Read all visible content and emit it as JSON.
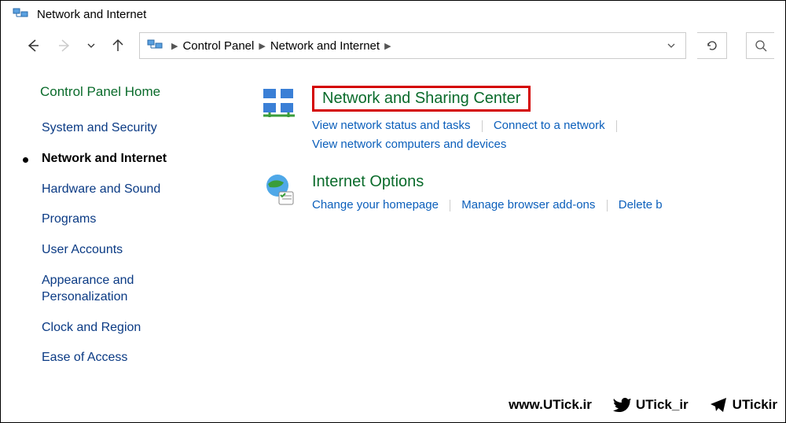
{
  "window": {
    "title": "Network and Internet"
  },
  "breadcrumb": {
    "root": "Control Panel",
    "current": "Network and Internet"
  },
  "sidebar": {
    "home": "Control Panel Home",
    "items": [
      {
        "label": "System and Security"
      },
      {
        "label": "Network and Internet",
        "active": true
      },
      {
        "label": "Hardware and Sound"
      },
      {
        "label": "Programs"
      },
      {
        "label": "User Accounts"
      },
      {
        "label": "Appearance and Personalization"
      },
      {
        "label": "Clock and Region"
      },
      {
        "label": "Ease of Access"
      }
    ]
  },
  "categories": [
    {
      "title": "Network and Sharing Center",
      "highlighted": true,
      "links": [
        "View network status and tasks",
        "Connect to a network",
        "View network computers and devices"
      ]
    },
    {
      "title": "Internet Options",
      "links": [
        "Change your homepage",
        "Manage browser add-ons",
        "Delete b"
      ]
    }
  ],
  "footer": {
    "site": "www.UTick.ir",
    "twitter": "UTick_ir",
    "telegram": "UTickir"
  }
}
